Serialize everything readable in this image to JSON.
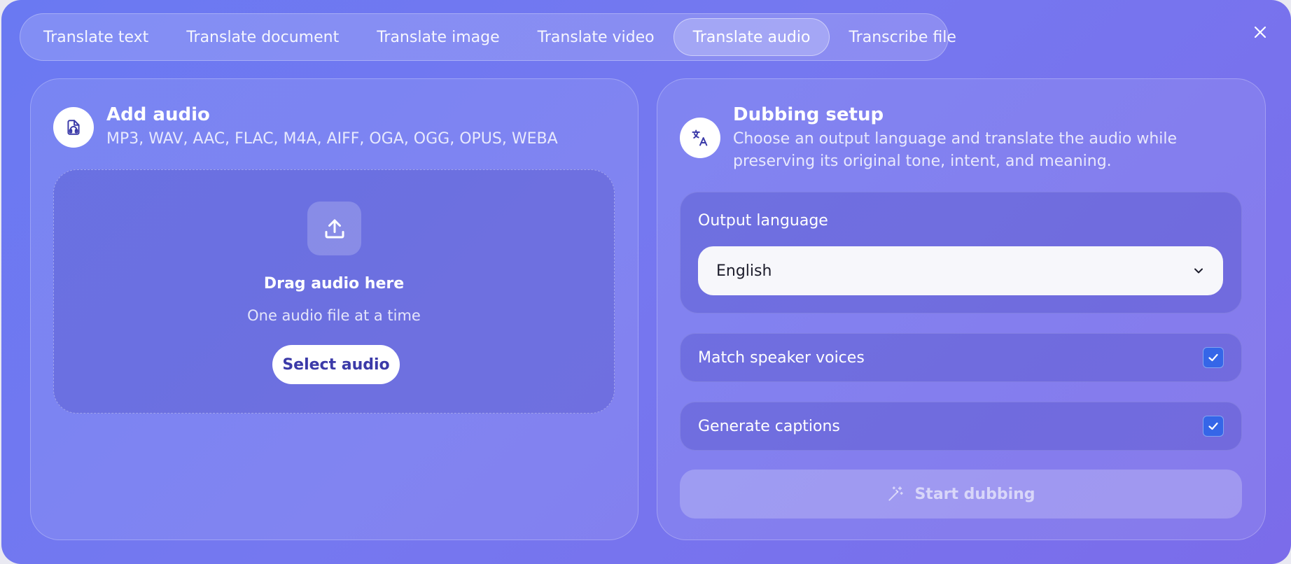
{
  "tabs": [
    {
      "label": "Translate text",
      "active": false
    },
    {
      "label": "Translate document",
      "active": false
    },
    {
      "label": "Translate image",
      "active": false
    },
    {
      "label": "Translate video",
      "active": false
    },
    {
      "label": "Translate audio",
      "active": true
    },
    {
      "label": "Transcribe file",
      "active": false
    }
  ],
  "close_icon": "close-icon",
  "add_audio": {
    "icon": "audio-file-icon",
    "title": "Add audio",
    "formats": "MP3, WAV, AAC, FLAC, M4A, AIFF, OGA, OGG, OPUS, WEBA",
    "dropzone": {
      "icon": "upload-icon",
      "title": "Drag audio here",
      "subtitle": "One audio file at a time",
      "button_label": "Select audio"
    }
  },
  "dubbing": {
    "icon": "translate-icon",
    "title": "Dubbing setup",
    "description": "Choose an output language and translate the audio while preserving its original tone, intent, and meaning.",
    "output_language": {
      "label": "Output language",
      "selected": "English",
      "icon": "chevron-down-icon"
    },
    "options": [
      {
        "label": "Match speaker voices",
        "checked": true
      },
      {
        "label": "Generate captions",
        "checked": true
      }
    ],
    "start_button": {
      "label": "Start dubbing",
      "icon": "magic-wand-icon",
      "disabled": true
    }
  },
  "colors": {
    "accent": "#3566e8",
    "modal_start": "#6a79f2",
    "modal_end": "#7b6cea",
    "button_text": "#3b3aa8"
  }
}
